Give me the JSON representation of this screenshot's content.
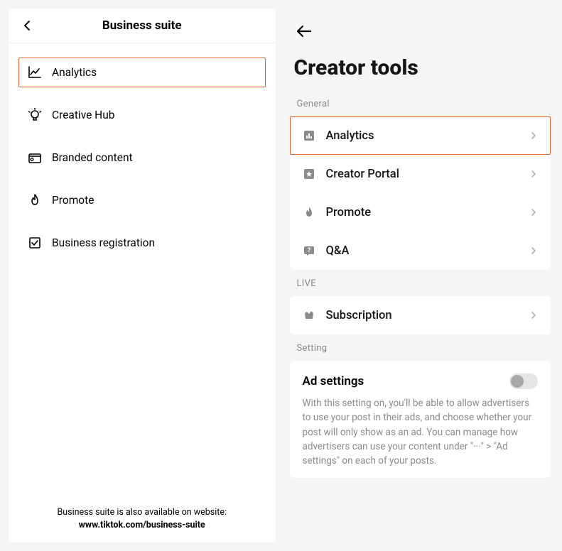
{
  "left": {
    "title": "Business suite",
    "items": [
      {
        "label": "Analytics",
        "highlighted": true
      },
      {
        "label": "Creative Hub",
        "highlighted": false
      },
      {
        "label": "Branded content",
        "highlighted": false
      },
      {
        "label": "Promote",
        "highlighted": false
      },
      {
        "label": "Business registration",
        "highlighted": false
      }
    ],
    "footer_prefix": "Business suite is also available on website: ",
    "footer_link": "www.tiktok.com/business-suite"
  },
  "right": {
    "title": "Creator tools",
    "sections": {
      "general_label": "General",
      "general_items": [
        {
          "label": "Analytics",
          "highlighted": true
        },
        {
          "label": "Creator Portal",
          "highlighted": false
        },
        {
          "label": "Promote",
          "highlighted": false
        },
        {
          "label": "Q&A",
          "highlighted": false
        }
      ],
      "live_label": "LIVE",
      "live_items": [
        {
          "label": "Subscription",
          "highlighted": false
        }
      ],
      "setting_label": "Setting",
      "ad_settings": {
        "title": "Ad settings",
        "description": "With this setting on, you'll be able to allow advertisers to use your post in their ads, and choose whether your post will only show as an ad. You can manage how advertisers can use your content under \"···\" > \"Ad settings\" on each of your posts.",
        "toggle_on": false
      }
    }
  }
}
